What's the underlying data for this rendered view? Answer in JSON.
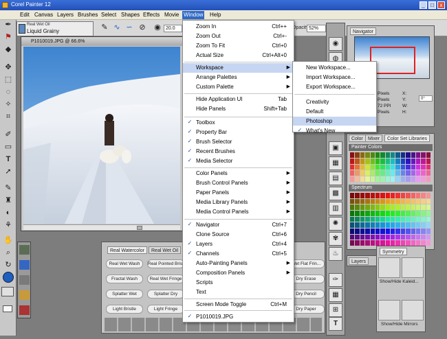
{
  "window": {
    "title": "Corel Painter 12",
    "controls": [
      "_",
      "□",
      "x"
    ]
  },
  "menubar": {
    "items": [
      "Edit",
      "Canvas",
      "Layers",
      "Brushes",
      "Select",
      "Shapes",
      "Effects",
      "Movie",
      "Window",
      "Help"
    ],
    "active": "Window"
  },
  "propbar": {
    "size_value": "20.0",
    "opacity_label": "Opacity:",
    "opacity_value": "52%"
  },
  "brush_selector": {
    "category": "Real Wet Oil",
    "variant": "Liquid Grainy"
  },
  "document": {
    "title": "P1010019.JPG @ 66.6%"
  },
  "window_menu": {
    "items": [
      {
        "label": "Zoom In",
        "shortcut": "Ctrl++"
      },
      {
        "label": "Zoom Out",
        "shortcut": "Ctrl+-"
      },
      {
        "label": "Zoom To Fit",
        "shortcut": "Ctrl+0"
      },
      {
        "label": "Actual Size",
        "shortcut": "Ctrl+Alt+0"
      },
      {
        "label": "Workspace",
        "submenu": true,
        "highlighted": true
      },
      {
        "label": "Arrange Palettes",
        "submenu": true
      },
      {
        "label": "Custom Palette",
        "submenu": true
      },
      {
        "label": "Hide Application UI",
        "shortcut": "Tab"
      },
      {
        "label": "Hide Panels",
        "shortcut": "Shift+Tab"
      },
      {
        "label": "Toolbox",
        "checked": true
      },
      {
        "label": "Property Bar",
        "checked": true
      },
      {
        "label": "Brush Selector",
        "checked": true
      },
      {
        "label": "Recent Brushes",
        "checked": true
      },
      {
        "label": "Media Selector",
        "checked": true
      },
      {
        "label": "Color Panels",
        "submenu": true
      },
      {
        "label": "Brush Control Panels",
        "submenu": true
      },
      {
        "label": "Paper Panels",
        "submenu": true
      },
      {
        "label": "Media Library Panels",
        "submenu": true
      },
      {
        "label": "Media Control Panels",
        "submenu": true
      },
      {
        "label": "Navigator",
        "shortcut": "Ctrl+7",
        "checked": true
      },
      {
        "label": "Clone Source",
        "shortcut": "Ctrl+6"
      },
      {
        "label": "Layers",
        "shortcut": "Ctrl+4",
        "checked": true
      },
      {
        "label": "Channels",
        "shortcut": "Ctrl+5",
        "checked": true
      },
      {
        "label": "Auto-Painting Panels",
        "submenu": true
      },
      {
        "label": "Composition Panels",
        "submenu": true
      },
      {
        "label": "Scripts"
      },
      {
        "label": "Text"
      },
      {
        "label": "Screen Mode Toggle",
        "shortcut": "Ctrl+M"
      },
      {
        "label": "P1010019.JPG",
        "checked": true
      }
    ]
  },
  "workspace_submenu": {
    "items": [
      {
        "label": "New Workspace..."
      },
      {
        "label": "Import Workspace..."
      },
      {
        "label": "Export Workspace..."
      },
      {
        "label": "Creativity"
      },
      {
        "label": "Default"
      },
      {
        "label": "Photoshop",
        "highlighted": true
      },
      {
        "label": "What's New",
        "checked": true
      }
    ]
  },
  "navigator": {
    "title": "Navigator",
    "readout": {
      "pixels": "Pixels",
      "dpi": "72 PPI",
      "x": "X:",
      "y": "Y:",
      "w": "W:",
      "h": "H:",
      "angle": "0°"
    }
  },
  "color_panels": {
    "tabs": [
      "Color",
      "Mixer",
      "Color Set Libraries"
    ],
    "painter_colors": "Painter Colors",
    "spectrum": "Spectrum"
  },
  "layers_panel": {
    "tab": "Layers"
  },
  "brush_library": {
    "tabs": [
      "Real Watercolor",
      "Real Wet Oil"
    ],
    "buttons": [
      [
        "Real Wet Wash",
        "Real Pointed Brist..."
      ],
      [
        "Fractal Wash",
        "Real Wet Fringe"
      ],
      [
        "Splatter Wet",
        "Splatter Dry"
      ],
      [
        "Light Bristle",
        "Light Fringe"
      ]
    ],
    "right_buttons": [
      "Wet Flat Frin...",
      "Dry Erase",
      "Dry Pencil",
      "Dry Paper"
    ]
  },
  "symmetry": {
    "title": "Symmetry",
    "show_kaleido": "Show/Hide Kaleid...",
    "show_mirrors": "Show/Hide Mirrors"
  },
  "colors": {
    "accent": "#316ac5",
    "titlebar": "#2350b8",
    "nav_frame": "#e02020"
  }
}
